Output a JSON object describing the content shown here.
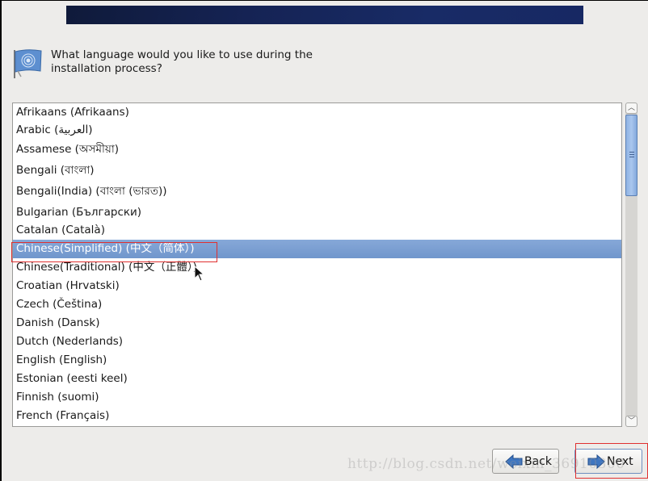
{
  "header": {
    "question": "What language would you like to use during the installation process?",
    "icon": "language-flag-icon"
  },
  "languages": [
    "Afrikaans (Afrikaans)",
    "Arabic (العربية)",
    "Assamese (অসমীয়া)",
    "Bengali (বাংলা)",
    "Bengali(India) (বাংলা (ভারত))",
    "Bulgarian (Български)",
    "Catalan (Català)",
    "Chinese(Simplified) (中文（简体）)",
    "Chinese(Traditional) (中文（正體）)",
    "Croatian (Hrvatski)",
    "Czech (Čeština)",
    "Danish (Dansk)",
    "Dutch (Nederlands)",
    "English (English)",
    "Estonian (eesti keel)",
    "Finnish (suomi)",
    "French (Français)"
  ],
  "selected_language": "Chinese(Simplified) (中文（简体）)",
  "scrollbar": {
    "position_fraction": 0.0
  },
  "buttons": {
    "back_label": "Back",
    "next_label": "Next"
  },
  "watermark": "http://blog.csdn.net/weixin_36910300",
  "colors": {
    "selection": "#7b9fd2",
    "highlight_box": "#e03030",
    "banner": "#172863"
  }
}
